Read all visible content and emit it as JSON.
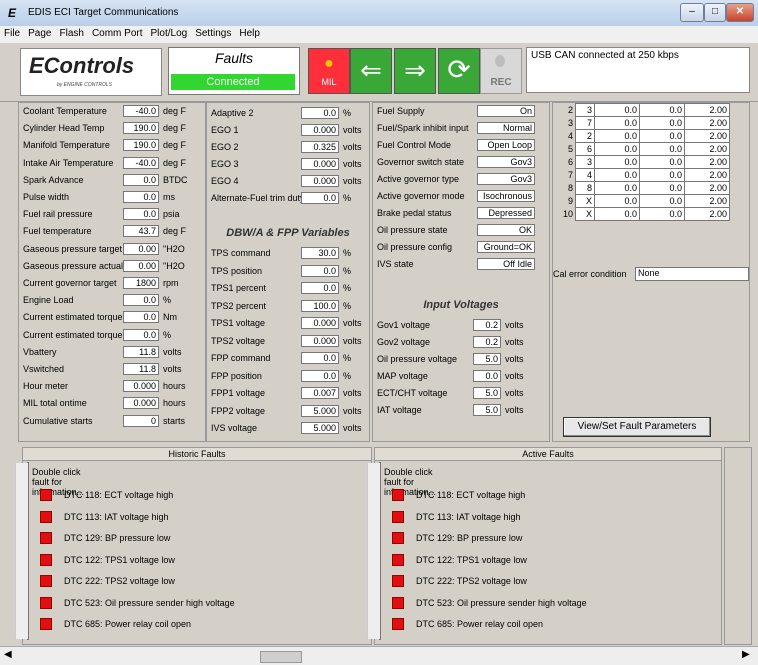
{
  "window": {
    "title": "EDIS ECI Target Communications",
    "app_letter": "E"
  },
  "menu": [
    "File",
    "Page",
    "Flash",
    "Comm Port",
    "Plot/Log",
    "Settings",
    "Help"
  ],
  "toolbar": {
    "logo_brand": "EControls",
    "logo_sub": "by ENGINE CONTROLS",
    "faults_label": "Faults",
    "faults_status": "Connected",
    "mil_label": "MIL",
    "rec_label": "REC",
    "usb_status": "USB CAN connected at 250 kbps"
  },
  "left_panel": [
    {
      "label": "Coolant Temperature",
      "value": "-40.0",
      "unit": "deg F"
    },
    {
      "label": "Cylinder Head Temp",
      "value": "190.0",
      "unit": "deg F"
    },
    {
      "label": "Manifold Temperature",
      "value": "190.0",
      "unit": "deg F"
    },
    {
      "label": "Intake Air Temperature",
      "value": "-40.0",
      "unit": "deg F"
    },
    {
      "label": "Spark Advance",
      "value": "0.0",
      "unit": "BTDC"
    },
    {
      "label": "Pulse width",
      "value": "0.0",
      "unit": "ms"
    },
    {
      "label": "Fuel rail pressure",
      "value": "0.0",
      "unit": "psia"
    },
    {
      "label": "Fuel temperature",
      "value": "43.7",
      "unit": "deg F"
    },
    {
      "label": "Gaseous pressure target",
      "value": "0.00",
      "unit": "\"H2O"
    },
    {
      "label": "Gaseous pressure actual",
      "value": "0.00",
      "unit": "\"H2O"
    },
    {
      "label": "Current governor target",
      "value": "1800",
      "unit": "rpm"
    },
    {
      "label": "Engine Load",
      "value": "0.0",
      "unit": "%"
    },
    {
      "label": "Current estimated torque",
      "value": "0.0",
      "unit": "Nm"
    },
    {
      "label": "Current estimated torque",
      "value": "0.0",
      "unit": "%"
    },
    {
      "label": "Vbattery",
      "value": "11.8",
      "unit": "volts"
    },
    {
      "label": "Vswitched",
      "value": "11.8",
      "unit": "volts"
    },
    {
      "label": "Hour meter",
      "value": "0.000",
      "unit": "hours"
    },
    {
      "label": "MIL total ontime",
      "value": "0.000",
      "unit": "hours"
    },
    {
      "label": "Cumulative starts",
      "value": "0",
      "unit": "starts"
    }
  ],
  "mid_panel": {
    "rows_top": [
      {
        "label": "Adaptive 2",
        "value": "0.0",
        "unit": "%"
      },
      {
        "label": "EGO 1",
        "value": "0.000",
        "unit": "volts"
      },
      {
        "label": "EGO 2",
        "value": "0.325",
        "unit": "volts"
      },
      {
        "label": "EGO 3",
        "value": "0.000",
        "unit": "volts"
      },
      {
        "label": "EGO 4",
        "value": "0.000",
        "unit": "volts"
      },
      {
        "label": "Alternate-Fuel trim duty-cycle",
        "value": "0.0",
        "unit": "%"
      }
    ],
    "section_title": "DBW/A & FPP Variables",
    "rows_bottom": [
      {
        "label": "TPS command",
        "value": "30.0",
        "unit": "%"
      },
      {
        "label": "TPS position",
        "value": "0.0",
        "unit": "%"
      },
      {
        "label": "TPS1 percent",
        "value": "0.0",
        "unit": "%"
      },
      {
        "label": "TPS2 percent",
        "value": "100.0",
        "unit": "%"
      },
      {
        "label": "TPS1 voltage",
        "value": "0.000",
        "unit": "volts"
      },
      {
        "label": "TPS2 voltage",
        "value": "0.000",
        "unit": "volts"
      },
      {
        "label": "FPP command",
        "value": "0.0",
        "unit": "%"
      },
      {
        "label": "FPP position",
        "value": "0.0",
        "unit": "%"
      },
      {
        "label": "FPP1 voltage",
        "value": "0.007",
        "unit": "volts"
      },
      {
        "label": "FPP2 voltage",
        "value": "5.000",
        "unit": "volts"
      },
      {
        "label": "IVS voltage",
        "value": "5.000",
        "unit": "volts"
      }
    ]
  },
  "right_mid": {
    "rows": [
      {
        "label": "Fuel Supply",
        "value": "On"
      },
      {
        "label": "Fuel/Spark inhibit input",
        "value": "Normal"
      },
      {
        "label": "Fuel Control Mode",
        "value": "Open Loop"
      },
      {
        "label": "Governor switch state",
        "value": "Gov3"
      },
      {
        "label": "Active governor type",
        "value": "Gov3"
      },
      {
        "label": "Active governor mode",
        "value": "Isochronous"
      },
      {
        "label": "Brake pedal status",
        "value": "Depressed"
      },
      {
        "label": "Oil pressure state",
        "value": "OK"
      },
      {
        "label": "Oil pressure config",
        "value": "Ground=OK"
      },
      {
        "label": "IVS state",
        "value": "Off Idle"
      }
    ],
    "section_title": "Input Voltages",
    "inputs": [
      {
        "label": "Gov1 voltage",
        "value": "0.2",
        "unit": "volts"
      },
      {
        "label": "Gov2 voltage",
        "value": "0.2",
        "unit": "volts"
      },
      {
        "label": "Oil pressure voltage",
        "value": "5.0",
        "unit": "volts"
      },
      {
        "label": "MAP voltage",
        "value": "0.0",
        "unit": "volts"
      },
      {
        "label": "ECT/CHT voltage",
        "value": "5.0",
        "unit": "volts"
      },
      {
        "label": "IAT voltage",
        "value": "5.0",
        "unit": "volts"
      }
    ]
  },
  "grid": {
    "rows": [
      {
        "n": "2",
        "a": "3",
        "b": "0.0",
        "c": "0.0",
        "d": "2.00"
      },
      {
        "n": "3",
        "a": "7",
        "b": "0.0",
        "c": "0.0",
        "d": "2.00"
      },
      {
        "n": "4",
        "a": "2",
        "b": "0.0",
        "c": "0.0",
        "d": "2.00"
      },
      {
        "n": "5",
        "a": "6",
        "b": "0.0",
        "c": "0.0",
        "d": "2.00"
      },
      {
        "n": "6",
        "a": "3",
        "b": "0.0",
        "c": "0.0",
        "d": "2.00"
      },
      {
        "n": "7",
        "a": "4",
        "b": "0.0",
        "c": "0.0",
        "d": "2.00"
      },
      {
        "n": "8",
        "a": "8",
        "b": "0.0",
        "c": "0.0",
        "d": "2.00"
      },
      {
        "n": "9",
        "a": "X",
        "b": "0.0",
        "c": "0.0",
        "d": "2.00"
      },
      {
        "n": "10",
        "a": "X",
        "b": "0.0",
        "c": "0.0",
        "d": "2.00"
      }
    ],
    "cal_error_label": "Cal error condition",
    "cal_error_value": "None",
    "fault_button": "View/Set Fault Parameters"
  },
  "historic": {
    "title": "Historic Faults",
    "hint": "Double click fault for information...",
    "items": [
      "DTC 118: ECT voltage high",
      "DTC 113: IAT voltage high",
      "DTC 129: BP pressure low",
      "DTC 122: TPS1 voltage low",
      "DTC 222: TPS2 voltage low",
      "DTC 523: Oil pressure sender high voltage",
      "DTC 685: Power relay coil open"
    ]
  },
  "active": {
    "title": "Active Faults",
    "hint": "Double click fault for information...",
    "items": [
      "DTC 118: ECT voltage high",
      "DTC 113: IAT voltage high",
      "DTC 129: BP pressure low",
      "DTC 122: TPS1 voltage low",
      "DTC 222: TPS2 voltage low",
      "DTC 523: Oil pressure sender high voltage",
      "DTC 685: Power relay coil open"
    ]
  },
  "colors": {
    "mil": "#ff2e3b",
    "connected": "#31d631",
    "arrows": "#3aa836",
    "dtc": "#e01010"
  }
}
